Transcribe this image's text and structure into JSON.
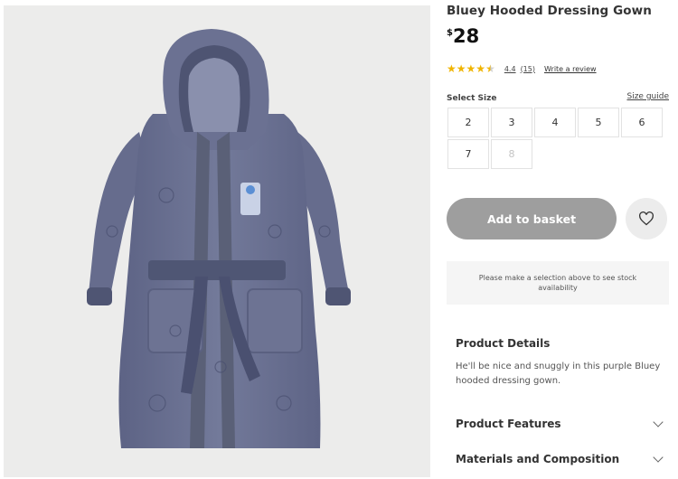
{
  "product": {
    "title": "Bluey Hooded Dressing Gown",
    "price_currency": "$",
    "price_amount": "28",
    "image_alt": "bluey-dressing-gown-image"
  },
  "rating": {
    "stars": 4.4,
    "value": "4.4",
    "count": "(15)",
    "write_review": "Write a review"
  },
  "size_selector": {
    "label": "Select Size",
    "guide": "Size guide",
    "options": [
      "2",
      "3",
      "4",
      "5",
      "6",
      "7",
      "8"
    ],
    "unavailable": [
      "8"
    ]
  },
  "actions": {
    "add_to_basket": "Add to basket",
    "wishlist_icon": "heart-icon"
  },
  "stock_note": "Please make a selection above to see stock availability",
  "details": {
    "title": "Product Details",
    "text": "He'll be nice and snuggly in this purple Bluey hooded dressing gown."
  },
  "accordions": [
    {
      "label": "Product Features",
      "icon": "chevron-down-icon"
    },
    {
      "label": "Materials and Composition",
      "icon": "chevron-down-icon"
    }
  ],
  "colors": {
    "robe": "#6c7291",
    "robe_dark": "#565c7a",
    "trim": "#5a6077",
    "button_disabled": "#9e9e9e",
    "star": "#f0b400"
  }
}
